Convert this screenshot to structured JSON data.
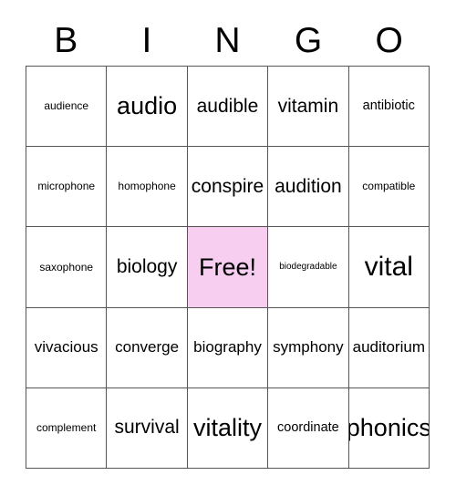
{
  "card": {
    "title_letters": [
      "B",
      "I",
      "N",
      "G",
      "O"
    ],
    "free_cell_color": "#f7cef0",
    "border_color": "#555555",
    "background_color": "#ffffff",
    "text_color": "#000000",
    "rows": [
      [
        {
          "label": "audience",
          "size": "s",
          "free": false
        },
        {
          "label": "audio",
          "size": "xxl",
          "free": false
        },
        {
          "label": "audible",
          "size": "xl",
          "free": false
        },
        {
          "label": "vitamin",
          "size": "xl",
          "free": false
        },
        {
          "label": "antibiotic",
          "size": "m",
          "free": false
        }
      ],
      [
        {
          "label": "microphone",
          "size": "s",
          "free": false
        },
        {
          "label": "homophone",
          "size": "s",
          "free": false
        },
        {
          "label": "conspire",
          "size": "xl",
          "free": false
        },
        {
          "label": "audition",
          "size": "xl",
          "free": false
        },
        {
          "label": "compatible",
          "size": "s",
          "free": false
        }
      ],
      [
        {
          "label": "saxophone",
          "size": "s",
          "free": false
        },
        {
          "label": "biology",
          "size": "xl",
          "free": false
        },
        {
          "label": "Free!",
          "size": "xxl",
          "free": true
        },
        {
          "label": "biodegradable",
          "size": "xs",
          "free": false
        },
        {
          "label": "vital",
          "size": "max",
          "free": false
        }
      ],
      [
        {
          "label": "vivacious",
          "size": "l",
          "free": false
        },
        {
          "label": "converge",
          "size": "l",
          "free": false
        },
        {
          "label": "biography",
          "size": "l",
          "free": false
        },
        {
          "label": "symphony",
          "size": "l",
          "free": false
        },
        {
          "label": "auditorium",
          "size": "l",
          "free": false
        }
      ],
      [
        {
          "label": "complement",
          "size": "s",
          "free": false
        },
        {
          "label": "survival",
          "size": "xl",
          "free": false
        },
        {
          "label": "vitality",
          "size": "xxl",
          "free": false
        },
        {
          "label": "coordinate",
          "size": "m",
          "free": false
        },
        {
          "label": "phonics",
          "size": "xxl",
          "free": false
        }
      ]
    ]
  }
}
